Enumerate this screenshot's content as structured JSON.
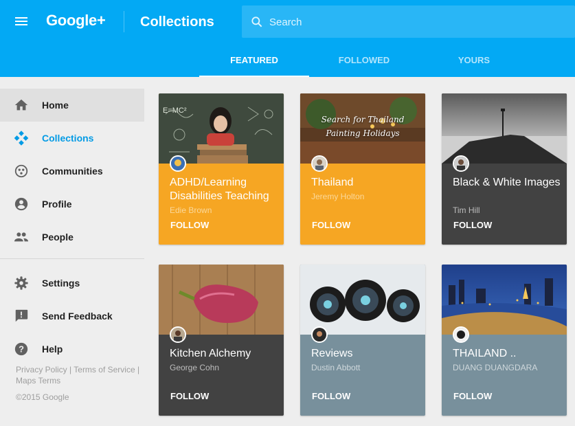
{
  "header": {
    "logo": "Google+",
    "title": "Collections",
    "search_placeholder": "Search",
    "tabs": [
      {
        "label": "FEATURED"
      },
      {
        "label": "FOLLOWED"
      },
      {
        "label": "YOURS"
      }
    ]
  },
  "sidebar": {
    "items": [
      {
        "label": "Home",
        "icon": "home-icon"
      },
      {
        "label": "Collections",
        "icon": "collections-icon"
      },
      {
        "label": "Communities",
        "icon": "communities-icon"
      },
      {
        "label": "Profile",
        "icon": "profile-icon"
      },
      {
        "label": "People",
        "icon": "people-icon"
      },
      {
        "label": "Settings",
        "icon": "gear-icon"
      },
      {
        "label": "Send Feedback",
        "icon": "feedback-icon"
      },
      {
        "label": "Help",
        "icon": "help-icon"
      }
    ],
    "footer": {
      "privacy": "Privacy Policy",
      "terms": "Terms of Service",
      "maps_terms": "Maps Terms",
      "copyright": "©2015 Google"
    }
  },
  "cards": [
    {
      "title": "ADHD/Learning Disabilities Teaching",
      "author": "Edie Brown",
      "follow": "FOLLOW",
      "color": "#f6a623"
    },
    {
      "title": "Thailand",
      "author": "Jeremy Holton",
      "follow": "FOLLOW",
      "color": "#f6a623",
      "image_text": "Search for Thailand Painting Holidays"
    },
    {
      "title": "Black & White Images",
      "author": "Tim Hill",
      "follow": "FOLLOW",
      "color": "#424242"
    },
    {
      "title": "Kitchen Alchemy",
      "author": "George Cohn",
      "follow": "FOLLOW",
      "color": "#424242"
    },
    {
      "title": "Reviews",
      "author": "Dustin Abbott",
      "follow": "FOLLOW",
      "color": "#78909c"
    },
    {
      "title": "THAILAND ..",
      "author": "DUANG DUANGDARA",
      "follow": "FOLLOW",
      "color": "#78909c"
    }
  ],
  "colors": {
    "primary": "#03a9f4",
    "accent_orange": "#f6a623",
    "dark_card": "#424242",
    "slate_card": "#78909c",
    "selected_nav": "#039be5"
  }
}
